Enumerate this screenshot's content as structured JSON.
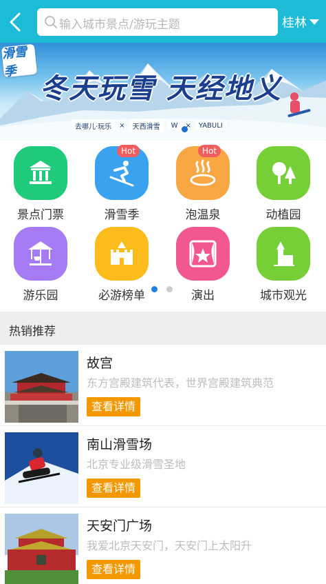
{
  "header": {
    "search_placeholder": "输入城市景点/游玩主题",
    "city": "桂林"
  },
  "banner": {
    "logo_text": "滑雪季",
    "title": "冬天玩雪 天经地义",
    "partners": [
      "去哪儿·玩乐",
      "天西滑雪",
      "W",
      "YABULI"
    ]
  },
  "categories": [
    {
      "label": "景点门票",
      "icon": "pavilion-icon",
      "color": "#1fcb7a",
      "hot": ""
    },
    {
      "label": "滑雪季",
      "icon": "skier-icon",
      "color": "#3aa3ef",
      "hot": "Hot"
    },
    {
      "label": "泡温泉",
      "icon": "hot-spring-icon",
      "color": "#f8a742",
      "hot": "Hot"
    },
    {
      "label": "动植园",
      "icon": "tree-icon",
      "color": "#77cf38",
      "hot": ""
    },
    {
      "label": "游乐园",
      "icon": "carousel-icon",
      "color": "#a57cf5",
      "hot": ""
    },
    {
      "label": "必游榜单",
      "icon": "castle-icon",
      "color": "#fdbb1c",
      "hot": ""
    },
    {
      "label": "演出",
      "icon": "stage-icon",
      "color": "#f2578f",
      "hot": ""
    },
    {
      "label": "城市观光",
      "icon": "tower-icon",
      "color": "#77cf38",
      "hot": ""
    }
  ],
  "pagination": {
    "active_page": 1,
    "pages": 2,
    "active_color": "#1e80e0",
    "inactive_color": "#cccccc"
  },
  "section": {
    "title": "热销推荐"
  },
  "items": [
    {
      "title": "故宫",
      "desc": "东方宫殿建筑代表，世界宫殿建筑典范",
      "button": "查看详情"
    },
    {
      "title": "南山滑雪场",
      "desc": "北京专业级滑雪圣地",
      "button": "查看详情"
    },
    {
      "title": "天安门广场",
      "desc": "我爱北京天安门，天安门上太阳升",
      "button": "查看详情"
    }
  ],
  "colors": {
    "header": "#1dbbd6",
    "button": "#f39800",
    "hot": "#f15c5c"
  }
}
